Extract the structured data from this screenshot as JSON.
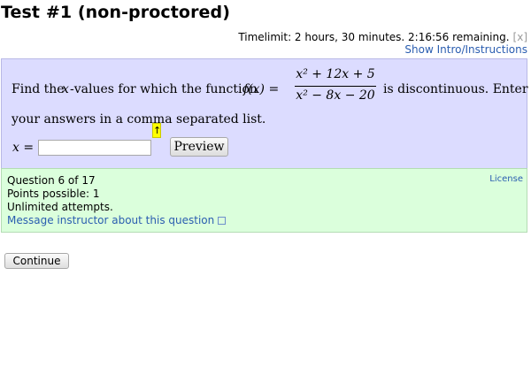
{
  "header": {
    "title": "Test #1 (non-proctored)",
    "timelimit_text": "Timelimit: 2 hours, 30 minutes. 2:16:56 remaining.",
    "close_label": "[x]",
    "intro_link": "Show Intro/Instructions"
  },
  "question": {
    "text_before": "Find the ",
    "var_x": "x",
    "text_mid": "-values for which the function ",
    "func": "f(x) =",
    "numerator": "x² + 12x + 5",
    "denominator": "x² − 8x − 20",
    "text_after": "is discontinuous. Enter",
    "line2": "your answers in a comma separated list.",
    "answer_label": "x =",
    "answer_value": "",
    "hint_arrow": "↑",
    "preview_label": "Preview"
  },
  "info": {
    "question_num": "Question 6 of 17",
    "points": "Points possible: 1",
    "attempts": "Unlimited attempts.",
    "message_link": "Message instructor about this question",
    "license": "License"
  },
  "footer": {
    "continue_label": "Continue"
  }
}
